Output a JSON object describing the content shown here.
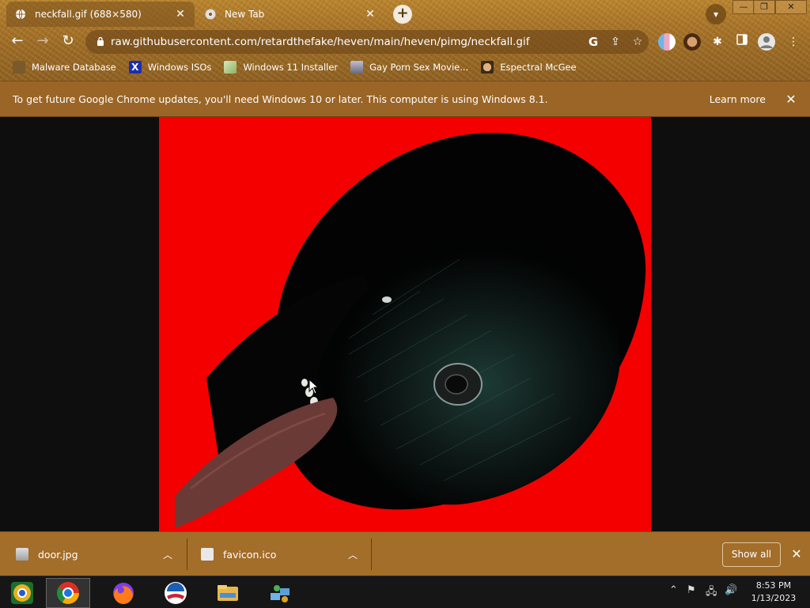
{
  "tabs": [
    {
      "title": "neckfall.gif (688×580)",
      "active": true,
      "icon": "globe-icon"
    },
    {
      "title": "New Tab",
      "active": false,
      "icon": "chrome-icon"
    }
  ],
  "window_controls": {
    "minimize": "—",
    "maximize": "❐",
    "close": "✕"
  },
  "toolbar": {
    "url": "raw.githubusercontent.com/retardthefake/heven/main/heven/pimg/neckfall.gif",
    "back": "←",
    "forward": "→",
    "reload": "↻"
  },
  "bookmarks": [
    {
      "label": "Malware Database",
      "icon": "malware-db-icon",
      "color": "#8a6a3a"
    },
    {
      "label": "Windows ISOs",
      "icon": "x-logo-icon",
      "color": "#1a2fb0"
    },
    {
      "label": "Windows 11 Installer",
      "icon": "installer-icon",
      "color": "#9bbf6a"
    },
    {
      "label": "Gay Porn Sex Movie...",
      "icon": "pc-icon",
      "color": "#7a7a9a"
    },
    {
      "label": "Espectral McGee",
      "icon": "face-icon",
      "color": "#c88a5a"
    }
  ],
  "infobar": {
    "message": "To get future Google Chrome updates, you'll need Windows 10 or later. This computer is using Windows 8.1.",
    "learn_more": "Learn more"
  },
  "downloads": [
    {
      "name": "door.jpg",
      "icon": "image-file-icon"
    },
    {
      "name": "favicon.ico",
      "icon": "file-icon"
    }
  ],
  "show_all": "Show all",
  "taskbar": {
    "apps": [
      "chrome-canary-icon",
      "chrome-icon",
      "firefox-icon",
      "obama-logo-icon",
      "file-explorer-icon",
      "network-icon"
    ]
  },
  "clock": {
    "time": "8:53 PM",
    "date": "1/13/2023"
  },
  "colors": {
    "accent": "#a36d2a",
    "gif_background": "#f40000"
  }
}
